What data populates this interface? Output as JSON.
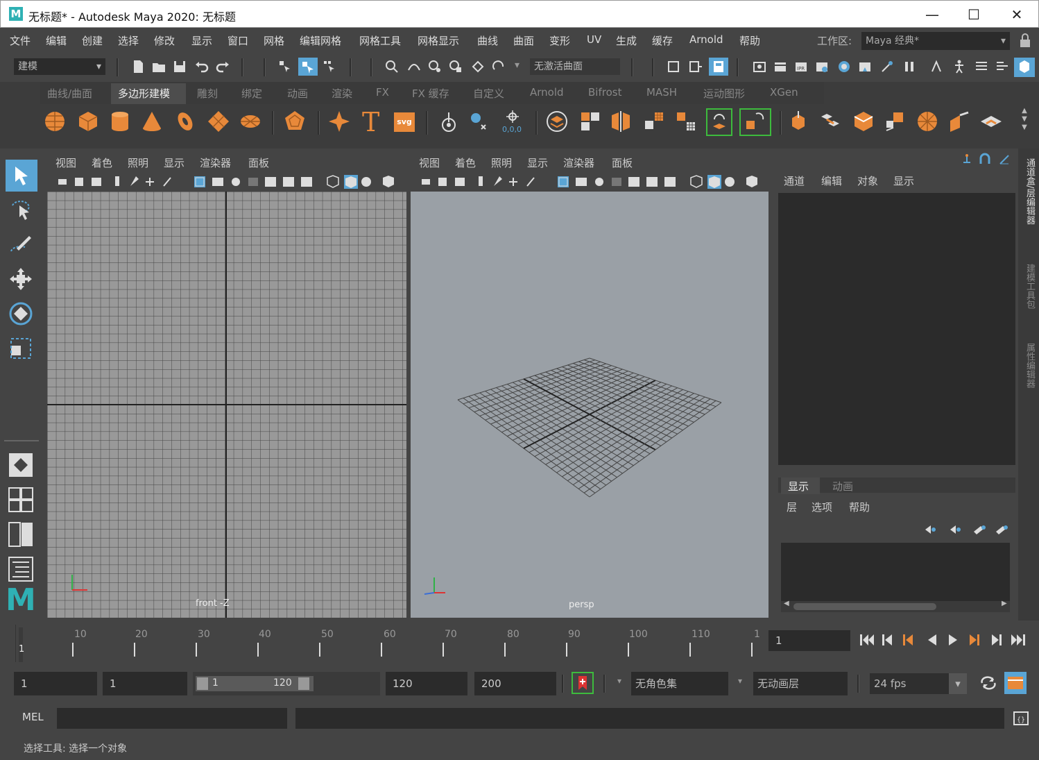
{
  "window": {
    "title": "无标题* - Autodesk Maya 2020: 无标题",
    "logo_letter": "M",
    "controls": {
      "minimize": "—",
      "maximize": "☐",
      "close": "✕"
    }
  },
  "menubar": {
    "items": [
      "文件",
      "编辑",
      "创建",
      "选择",
      "修改",
      "显示",
      "窗口",
      "网格",
      "编辑网格",
      "网格工具",
      "网格显示",
      "曲线",
      "曲面",
      "变形",
      "UV",
      "生成",
      "缓存",
      "Arnold",
      "帮助"
    ],
    "workspace_label": "工作区:",
    "workspace_value": "Maya 经典*"
  },
  "toolbar": {
    "mode_value": "建模",
    "live_surface": "无激活曲面"
  },
  "shelf": {
    "tabs": [
      "曲线/曲面",
      "多边形建模",
      "雕刻",
      "绑定",
      "动画",
      "渲染",
      "FX",
      "FX 缓存",
      "自定义",
      "Arnold",
      "Bifrost",
      "MASH",
      "运动图形",
      "XGen"
    ],
    "active_tab": "多边形建模",
    "text_icon": "T",
    "svg_icon": "svg",
    "origin_label": "0,0,0"
  },
  "viewport_left": {
    "menu": [
      "视图",
      "着色",
      "照明",
      "显示",
      "渲染器",
      "面板"
    ],
    "camera_label": "front -Z"
  },
  "viewport_right": {
    "menu": [
      "视图",
      "着色",
      "照明",
      "显示",
      "渲染器",
      "面板"
    ],
    "camera_label": "persp"
  },
  "channel_box": {
    "menu": [
      "通道",
      "编辑",
      "对象",
      "显示"
    ]
  },
  "layer_editor": {
    "tabs": [
      "显示",
      "动画"
    ],
    "menu": [
      "层",
      "选项",
      "帮助"
    ]
  },
  "side_tabs": [
    "通道盒/层编辑器",
    "建模工具包",
    "属性编辑器"
  ],
  "timeline": {
    "ticks": [
      "10",
      "20",
      "30",
      "40",
      "50",
      "60",
      "70",
      "80",
      "90",
      "100",
      "110",
      "1"
    ],
    "start_marker": "1",
    "current_frame": "1"
  },
  "range": {
    "start_field": "1",
    "playback_start": "1",
    "slider_start": "1",
    "slider_end": "120",
    "playback_end": "120",
    "end_field": "200",
    "character_set": "无角色集",
    "anim_layer": "无动画层",
    "fps": "24 fps"
  },
  "command": {
    "mode_label": "MEL"
  },
  "helpline": {
    "text": "选择工具: 选择一个对象"
  },
  "colors": {
    "accent_orange": "#e8893a",
    "active_blue": "#5aa5d5",
    "maya_teal": "#2fb1b4"
  }
}
